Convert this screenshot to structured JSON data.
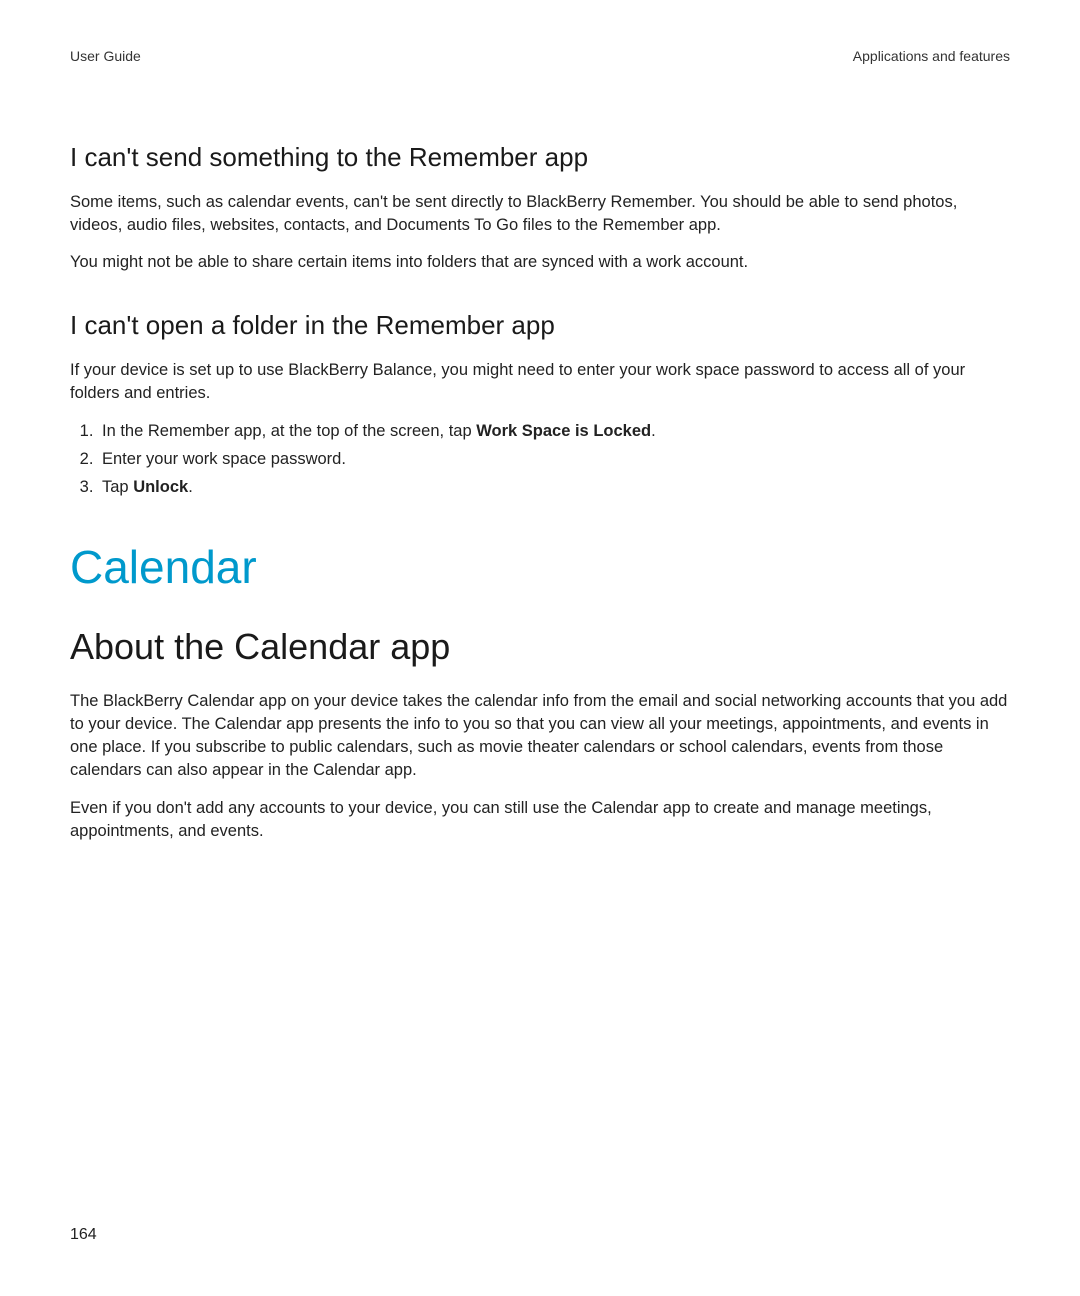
{
  "header": {
    "left": "User Guide",
    "right": "Applications and features"
  },
  "section1": {
    "heading": "I can't send something to the Remember app",
    "p1": "Some items, such as calendar events, can't be sent directly to BlackBerry Remember. You should be able to send photos, videos, audio files, websites, contacts, and Documents To Go files to the Remember app.",
    "p2": "You might not be able to share certain items into folders that are synced with a work account."
  },
  "section2": {
    "heading": "I can't open a folder in the Remember app",
    "p1": "If your device is set up to use BlackBerry Balance, you might need to enter your work space password to access all of your folders and entries.",
    "li1_pre": "In the Remember app, at the top of the screen, tap ",
    "li1_bold": "Work Space is Locked",
    "li1_post": ".",
    "li2": "Enter your work space password.",
    "li3_pre": "Tap ",
    "li3_bold": "Unlock",
    "li3_post": "."
  },
  "section3": {
    "h1": "Calendar",
    "h2": "About the Calendar app",
    "p1": "The BlackBerry Calendar app on your device takes the calendar info from the email and social networking accounts that you add to your device. The Calendar app presents the info to you so that you can view all your meetings, appointments, and events in one place. If you subscribe to public calendars, such as movie theater calendars or school calendars, events from those calendars can also appear in the Calendar app.",
    "p2": "Even if you don't add any accounts to your device, you can still use the Calendar app to create and manage meetings, appointments, and events."
  },
  "pageNumber": "164"
}
